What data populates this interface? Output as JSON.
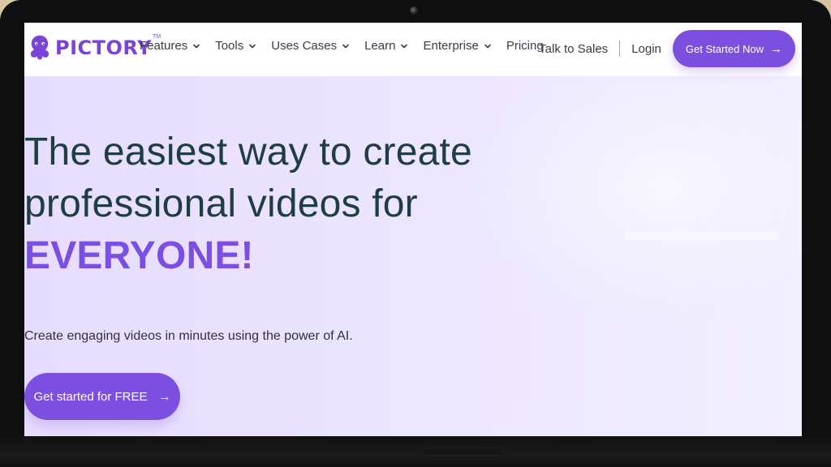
{
  "brand": {
    "name": "PICTORY",
    "trademark": "TM",
    "primary_color": "#7c4fe0",
    "logo_color": "#7a45d6",
    "icon": "octopus-icon"
  },
  "nav": {
    "items": [
      {
        "label": "Features",
        "has_dropdown": true,
        "icon": "chevron-down-icon"
      },
      {
        "label": "Tools",
        "has_dropdown": true,
        "icon": "chevron-down-icon"
      },
      {
        "label": "Uses Cases",
        "has_dropdown": true,
        "icon": "chevron-down-icon"
      },
      {
        "label": "Learn",
        "has_dropdown": true,
        "icon": "chevron-down-icon"
      },
      {
        "label": "Enterprise",
        "has_dropdown": true,
        "icon": "chevron-down-icon"
      },
      {
        "label": "Pricing",
        "has_dropdown": false
      }
    ],
    "right": {
      "talk_to_sales": "Talk to Sales",
      "login": "Login",
      "cta": "Get Started Now"
    }
  },
  "hero": {
    "headline_line1": "The easiest way to create",
    "headline_line2": "professional videos for",
    "headline_accent": "EVERYONE!",
    "subheadline": "Create engaging videos in minutes using the power of AI.",
    "cta": "Get started for FREE"
  }
}
